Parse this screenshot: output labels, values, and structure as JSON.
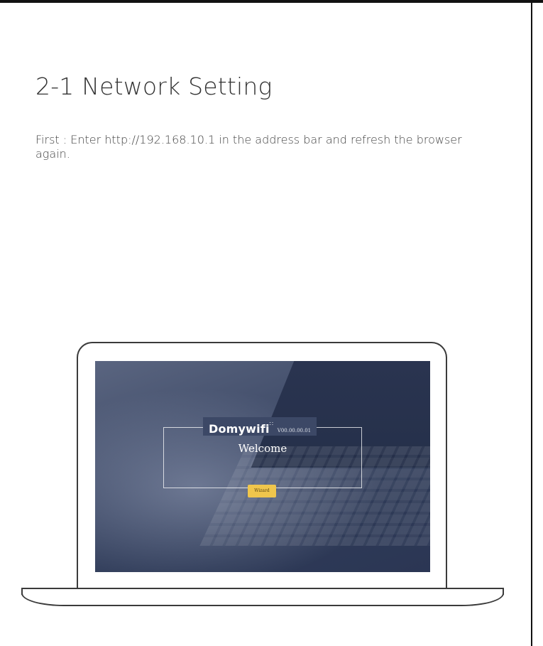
{
  "page": {
    "title": "2-1 Network Setting",
    "instruction": "First : Enter http://192.168.10.1 in the address bar and refresh the browser again."
  },
  "screen": {
    "logo": "Domywifi",
    "version": "V00.00.00.01",
    "welcome": "Welcome",
    "wizard_label": "Wizard"
  },
  "colors": {
    "screen_bg": "#3f4b68",
    "wizard_button": "#f0c64c",
    "frame": "#111111"
  }
}
